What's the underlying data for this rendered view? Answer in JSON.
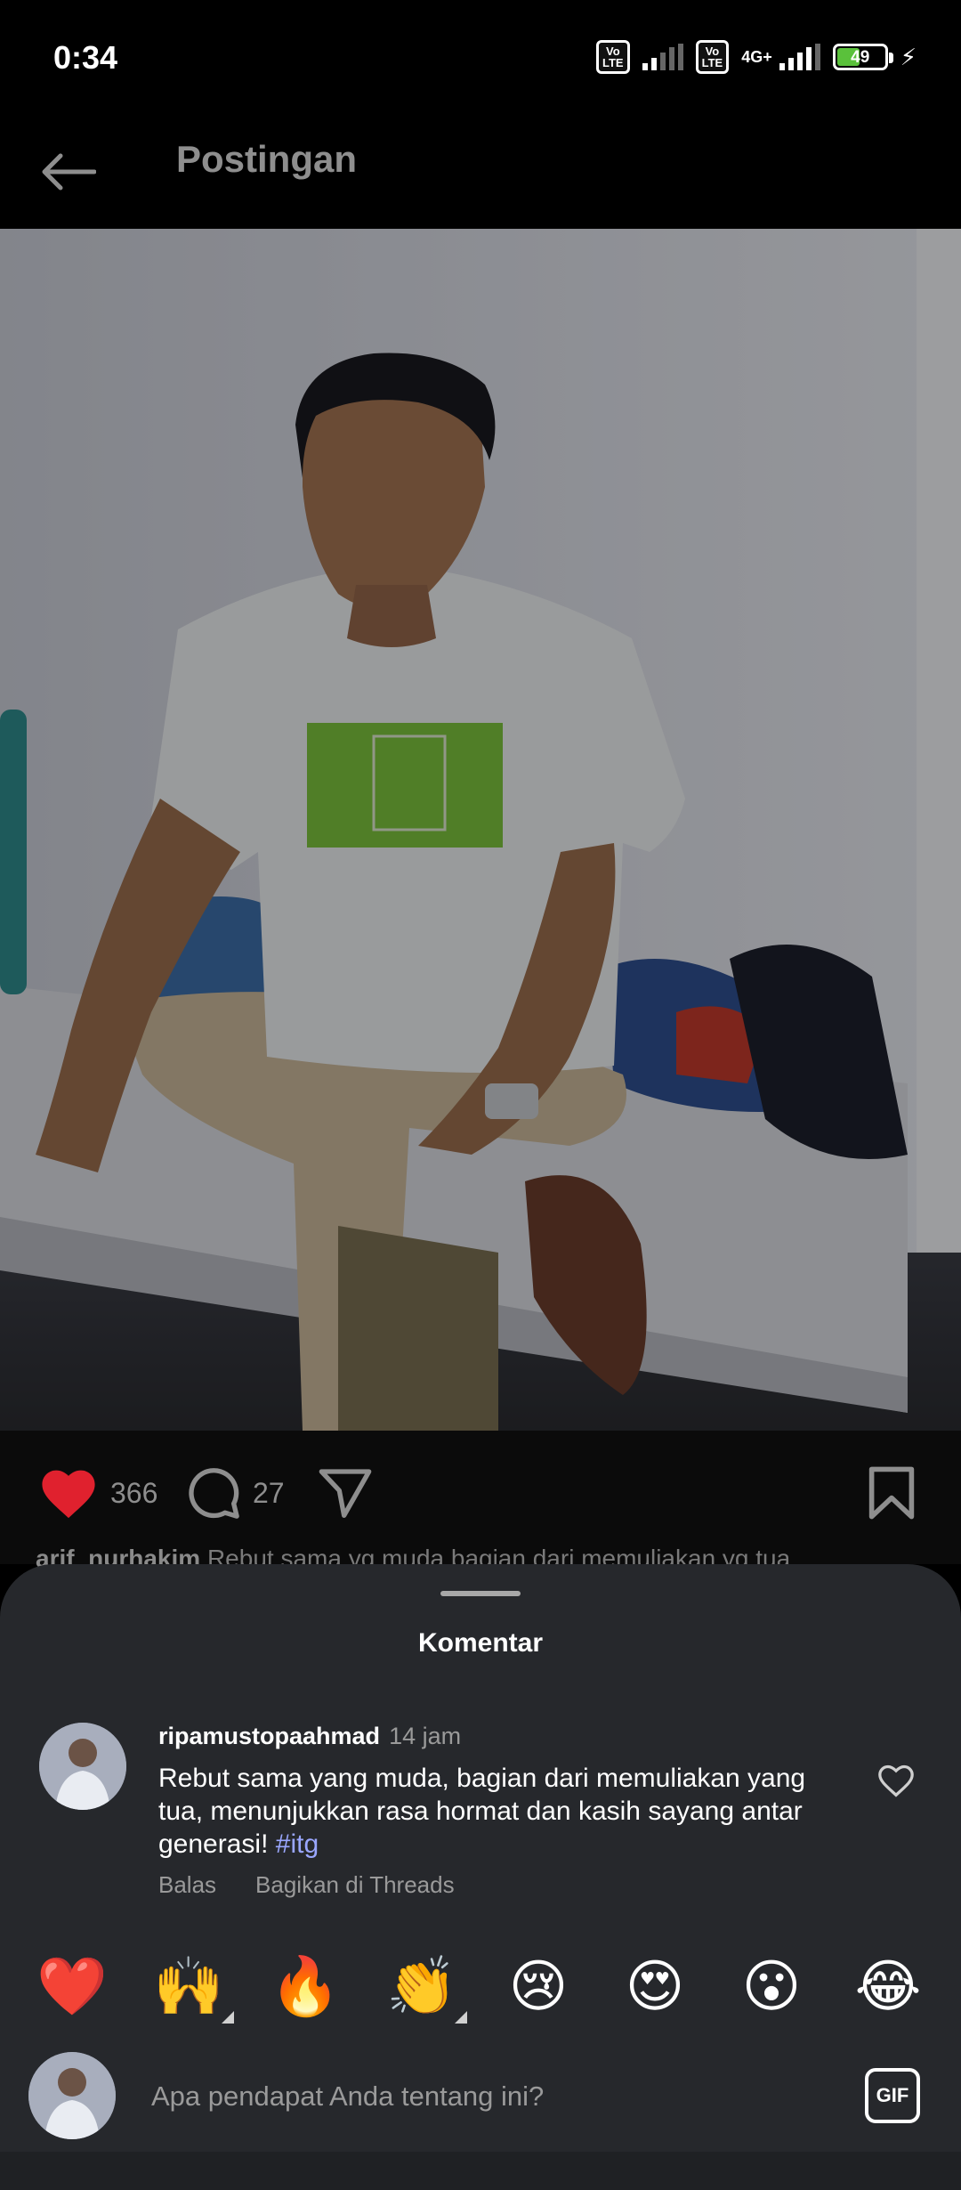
{
  "status_bar": {
    "time": "0:34",
    "battery_level": "49",
    "network": "4G+",
    "volte_label": "Vo LTE"
  },
  "header": {
    "title": "Postingan"
  },
  "post": {
    "likes": "366",
    "comments": "27",
    "caption_user": "arif_nurhakim",
    "caption_text": "Rebut sama yg muda bagian dari memuliakan yg tua"
  },
  "comments_sheet": {
    "title": "Komentar",
    "comment": {
      "username": "ripamustopaahmad",
      "time": "14 jam",
      "text": "Rebut sama yang muda, bagian dari memuliakan yang tua, menunjukkan rasa hormat dan kasih sayang antar generasi!",
      "hashtag": "#itg",
      "reply_label": "Balas",
      "share_label": "Bagikan di Threads"
    },
    "quick_reactions": [
      "❤️",
      "🙌",
      "🔥",
      "👏",
      "😢",
      "😍",
      "😮",
      "😂"
    ],
    "input_placeholder": "Apa pendapat Anda tentang ini?",
    "gif_label": "GIF"
  },
  "colors": {
    "like_red": "#e0212e",
    "hashtag": "#9aa7ff",
    "sheet_bg": "#26282c"
  }
}
